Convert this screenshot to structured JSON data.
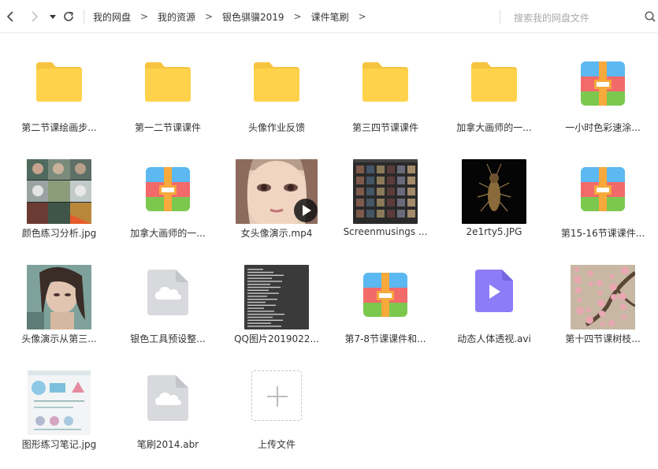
{
  "nav": {
    "back_icon": "chevron-left-icon",
    "forward_icon": "chevron-right-icon",
    "history_icon": "caret-down-icon",
    "refresh_icon": "refresh-icon"
  },
  "breadcrumb": {
    "items": [
      "我的网盘",
      "我的资源",
      "银色骐骥2019",
      "课件笔刷"
    ],
    "separator": ">"
  },
  "search": {
    "placeholder": "搜索我的网盘文件",
    "icon": "search-icon"
  },
  "colors": {
    "folder": "#FFD24C",
    "folder_tab": "#F6C43E",
    "zip_blue": "#5BB8F0",
    "zip_red": "#F26A6A",
    "zip_green": "#7CC84F",
    "zip_strap": "#F7A93B",
    "video_purple": "#8C7CF7",
    "cloud_gray": "#D8D9DD"
  },
  "files": [
    {
      "name": "第二节课绘画步...",
      "type": "folder",
      "icon": "folder-icon"
    },
    {
      "name": "第一二节课课件",
      "type": "folder",
      "icon": "folder-icon"
    },
    {
      "name": "头像作业反馈",
      "type": "folder",
      "icon": "folder-icon"
    },
    {
      "name": "第三四节课课件",
      "type": "folder",
      "icon": "folder-icon"
    },
    {
      "name": "加拿大画师的一...",
      "type": "folder",
      "icon": "folder-icon"
    },
    {
      "name": "一小时色彩速涂...",
      "type": "zip",
      "icon": "archive-icon"
    },
    {
      "name": "颜色练习分析.jpg",
      "type": "image",
      "icon": "image-thumbnail"
    },
    {
      "name": "加拿大画师的一...",
      "type": "zip",
      "icon": "archive-icon"
    },
    {
      "name": "女头像演示.mp4",
      "type": "video-thumb",
      "icon": "video-thumbnail"
    },
    {
      "name": "Screenmusings ...",
      "type": "image",
      "icon": "image-thumbnail"
    },
    {
      "name": "2e1rty5.JPG",
      "type": "image",
      "icon": "image-thumbnail"
    },
    {
      "name": "第15-16节课课件...",
      "type": "zip",
      "icon": "archive-icon"
    },
    {
      "name": "头像演示从第三...",
      "type": "image",
      "icon": "image-thumbnail"
    },
    {
      "name": "银色工具预设整...",
      "type": "cloud",
      "icon": "cloud-file-icon"
    },
    {
      "name": "QQ图片2019022...",
      "type": "image",
      "icon": "image-thumbnail"
    },
    {
      "name": "第7-8节课课件和...",
      "type": "zip",
      "icon": "archive-icon"
    },
    {
      "name": "动态人体透视.avi",
      "type": "video",
      "icon": "video-file-icon"
    },
    {
      "name": "第十四节课树枝...",
      "type": "image",
      "icon": "image-thumbnail"
    },
    {
      "name": "图形练习笔记.jpg",
      "type": "image",
      "icon": "image-thumbnail"
    },
    {
      "name": "笔刷2014.abr",
      "type": "cloud",
      "icon": "cloud-file-icon"
    },
    {
      "name": "上传文件",
      "type": "upload",
      "icon": "plus-icon"
    }
  ]
}
